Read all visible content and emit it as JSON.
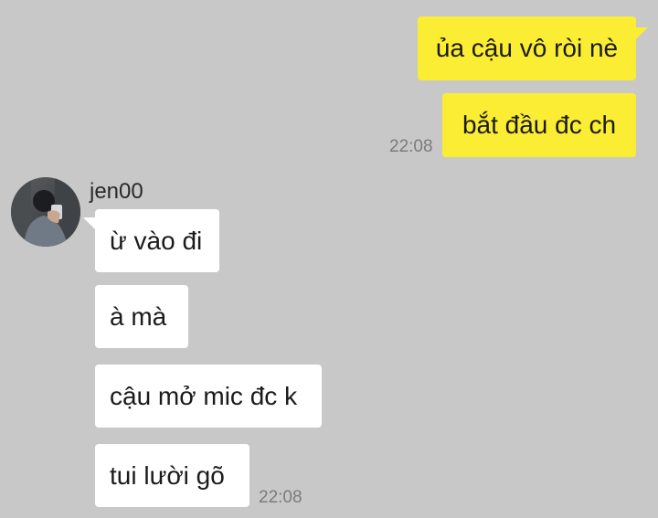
{
  "outgoing": {
    "messages": [
      {
        "text": "ủa cậu vô ròi nè"
      },
      {
        "text": "bắt đầu đc ch"
      }
    ],
    "time": "22:08"
  },
  "incoming": {
    "sender": "jen00",
    "avatar_icon": "profile-photo",
    "messages": [
      {
        "text": "ừ vào đi"
      },
      {
        "text": "à mà"
      },
      {
        "text": "cậu mở mic đc k"
      },
      {
        "text": "tui lười gõ"
      }
    ],
    "time": "22:08"
  },
  "colors": {
    "background": "#c8c8c8",
    "outgoing_bubble": "#fbed33",
    "incoming_bubble": "#ffffff",
    "timestamp": "#7b7b7b"
  }
}
